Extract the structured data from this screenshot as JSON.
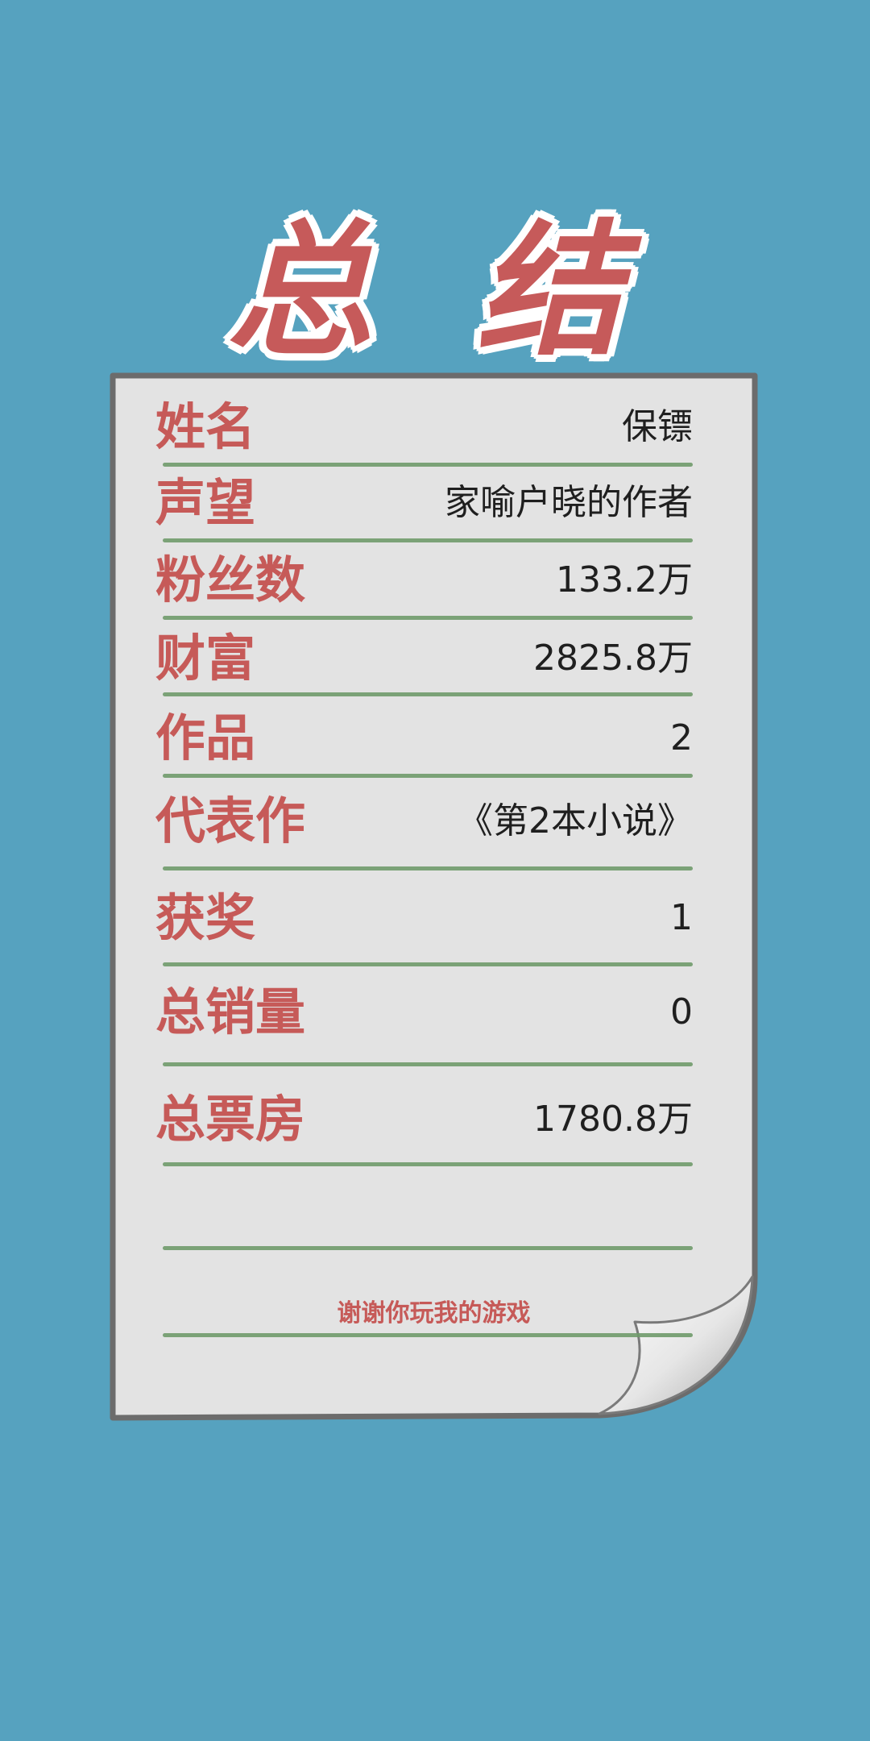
{
  "title": "总结",
  "rows": [
    {
      "label": "姓名",
      "value": "保镖"
    },
    {
      "label": "声望",
      "value": "家喻户晓的作者"
    },
    {
      "label": "粉丝数",
      "value": "133.2万"
    },
    {
      "label": "财富",
      "value": "2825.8万"
    },
    {
      "label": "作品",
      "value": "2"
    },
    {
      "label": "代表作",
      "value": "《第2本小说》"
    },
    {
      "label": "获奖",
      "value": "1"
    },
    {
      "label": "总销量",
      "value": "0"
    },
    {
      "label": "总票房",
      "value": "1780.8万"
    }
  ],
  "footer": "谢谢你玩我的游戏",
  "colors": {
    "background": "#56a2bf",
    "title": "#c65a5a",
    "label": "#c65a58",
    "value": "#1f1f1f",
    "rule": "#6f9a6a",
    "paper": "#e3e3e3",
    "paper_border": "#6c6c6c"
  }
}
